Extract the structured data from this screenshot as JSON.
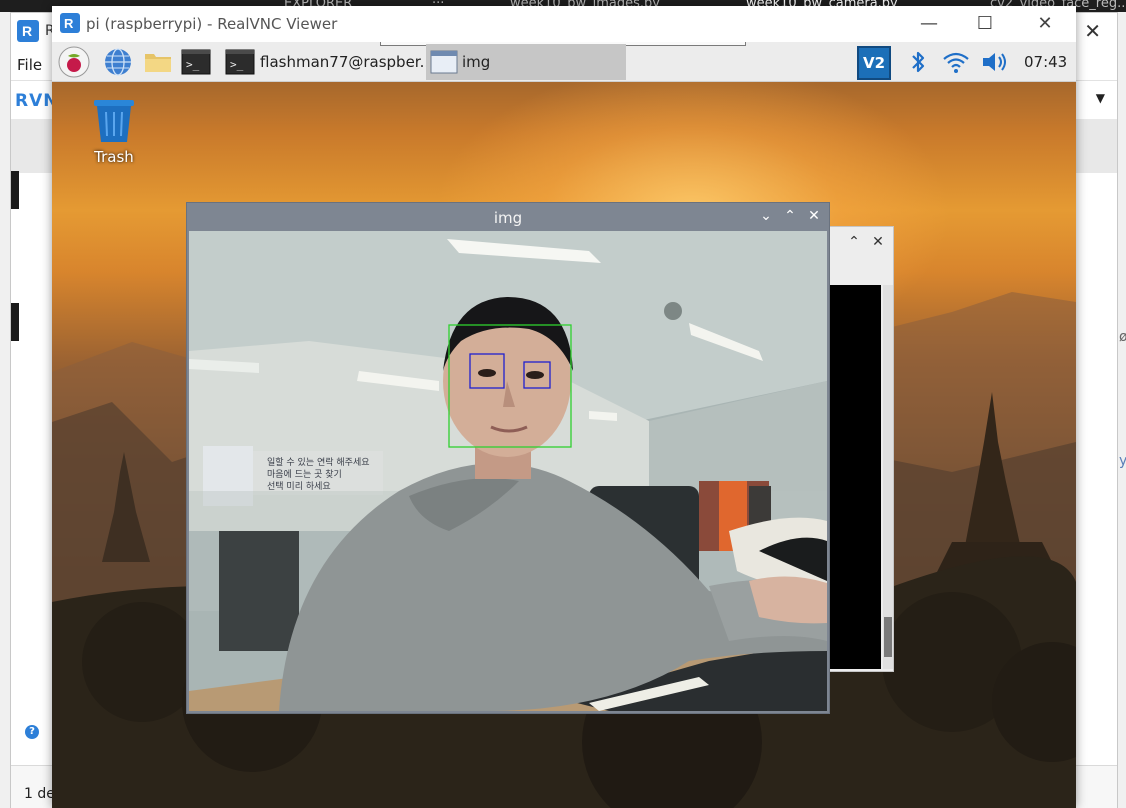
{
  "vscode": {
    "tabs": [
      "EXPLORER",
      "···",
      "week10_bw_images.py",
      "week10_bw_camera.py",
      "cv2_video_face_reg..."
    ]
  },
  "vnc_main": {
    "title": "R",
    "menu_file": "File",
    "brand": "RVNC",
    "status": "1 de",
    "right_edge_a": "ø",
    "right_edge_b": "y"
  },
  "viewer": {
    "title": "pi (raspberrypi) - RealVNC Viewer",
    "minimize": "—",
    "maximize": "☐",
    "close": "✕"
  },
  "taskbar": {
    "terminal_task": "flashman77@raspber...",
    "img_task": "img",
    "vnc_tray": "V2",
    "clock": "07:43"
  },
  "desktop": {
    "trash_label": "Trash"
  },
  "img_window": {
    "title": "img",
    "ctl_min": "⌄",
    "ctl_max": "⌃",
    "ctl_close": "✕"
  },
  "terminal_window": {
    "ctl_max": "⌃",
    "ctl_close": "✕"
  },
  "face_detection": {
    "face_color": "#2fd12f",
    "eye_color": "#2020d0"
  },
  "colors": {
    "vnc_blue": "#1c6fb8",
    "window_title_gray": "#7e8692",
    "taskbar": "#ececec"
  },
  "icons": [
    "raspberry-icon",
    "globe-icon",
    "folder-icon",
    "terminal-icon",
    "bluetooth-icon",
    "wifi-icon",
    "volume-icon",
    "trash-icon"
  ]
}
